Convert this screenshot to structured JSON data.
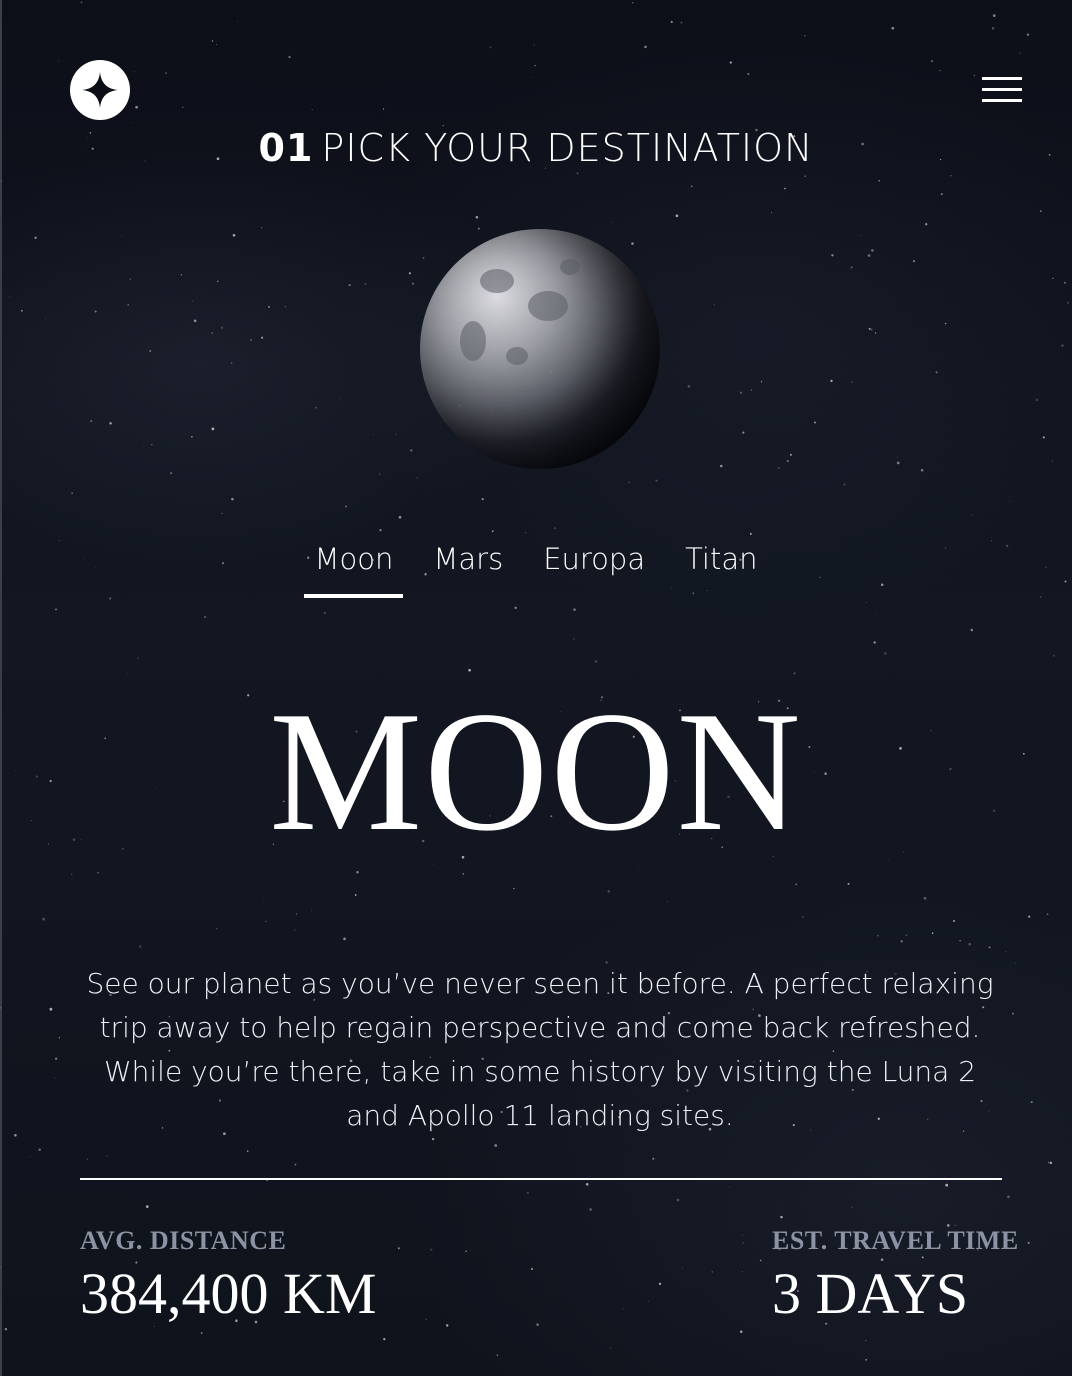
{
  "header": {
    "logo_icon": "star-logo-icon",
    "menu_icon": "hamburger-menu-icon"
  },
  "heading": {
    "number": "01",
    "title": "PICK YOUR DESTINATION"
  },
  "tabs": [
    {
      "label": "Moon",
      "active": true
    },
    {
      "label": "Mars",
      "active": false
    },
    {
      "label": "Europa",
      "active": false
    },
    {
      "label": "Titan",
      "active": false
    }
  ],
  "destination": {
    "name": "MOON",
    "description": "See our planet as you’ve never seen it before. A perfect relaxing trip away to help regain perspective and come back refreshed. While you’re there, take in some history by visiting the Luna 2 and Apollo 11 landing sites.",
    "stats": {
      "distance_label": "AVG. DISTANCE",
      "distance_value": "384,400 KM",
      "travel_label": "EST. TRAVEL TIME",
      "travel_value": "3 DAYS"
    }
  },
  "colors": {
    "background": "#0b0d17",
    "text": "#ffffff",
    "muted": "#8d93a4"
  }
}
